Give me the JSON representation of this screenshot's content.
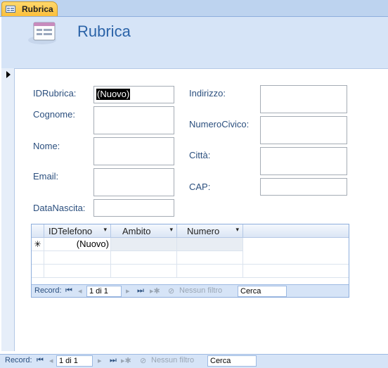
{
  "tab": {
    "label": "Rubrica",
    "icon": "form-icon"
  },
  "header": {
    "title": "Rubrica",
    "icon": "form-icon"
  },
  "form": {
    "left_fields": [
      {
        "label": "IDRubrica:",
        "value": "(Nuovo)"
      },
      {
        "label": "Cognome:",
        "value": ""
      },
      {
        "label": "Nome:",
        "value": ""
      },
      {
        "label": "Email:",
        "value": ""
      },
      {
        "label": "DataNascita:",
        "value": ""
      }
    ],
    "right_fields": [
      {
        "label": "Indirizzo:",
        "value": ""
      },
      {
        "label": "NumeroCivico:",
        "value": ""
      },
      {
        "label": "Città:",
        "value": ""
      },
      {
        "label": "CAP:",
        "value": ""
      }
    ]
  },
  "subform": {
    "columns": [
      "IDTelefono",
      "Ambito",
      "Numero"
    ],
    "new_row_marker": "✳",
    "new_row_value": "(Nuovo)",
    "nav": {
      "label": "Record:",
      "position": "1 di 1",
      "filter": "Nessun filtro",
      "search": "Cerca"
    }
  },
  "nav": {
    "label": "Record:",
    "position": "1 di 1",
    "filter": "Nessun filtro",
    "search": "Cerca"
  },
  "colors": {
    "accent": "#2b63a8",
    "header_bg": "#d6e4f7",
    "tab_bg": "#fbbf3b"
  }
}
